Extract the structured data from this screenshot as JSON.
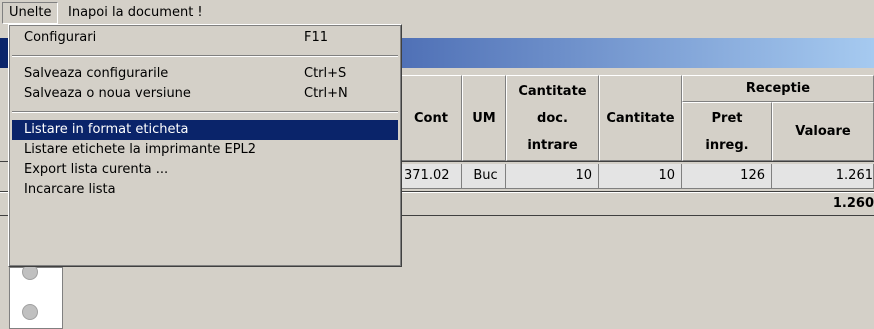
{
  "menubar": {
    "menus": [
      {
        "label": "Unelte"
      },
      {
        "label": "Inapoi la document !"
      }
    ]
  },
  "dropdown": {
    "items": [
      {
        "label": "Configurari",
        "shortcut": "F11"
      },
      {
        "label": "Salveaza configurarile",
        "shortcut": "Ctrl+S"
      },
      {
        "label": "Salveaza o noua versiune",
        "shortcut": "Ctrl+N"
      },
      {
        "label": "Listare in format eticheta",
        "shortcut": ""
      },
      {
        "label": "Listare etichete la imprimante EPL2",
        "shortcut": ""
      },
      {
        "label": "Export lista curenta ...",
        "shortcut": ""
      },
      {
        "label": "Incarcare lista",
        "shortcut": ""
      }
    ]
  },
  "table": {
    "headers": {
      "cont": "Cont",
      "um": "UM",
      "cantitate_doc_1": "Cantitate",
      "cantitate_doc_2": "doc.",
      "cantitate_doc_3": "intrare",
      "cantitate": "Cantitate",
      "receptie": "Receptie",
      "pret_1": "Pret",
      "pret_2": "inreg.",
      "valoare": "Valoare"
    },
    "row": {
      "cont": "371.02",
      "um": "Buc",
      "cantitate_doc": "10",
      "cantitate": "10",
      "pret": "126",
      "valoare": "1.261"
    },
    "total": "1.260"
  },
  "colors": {
    "face": "#d4d0c8",
    "selection": "#0a246a",
    "title_start": "#0a246a",
    "title_end": "#a6caf0"
  }
}
